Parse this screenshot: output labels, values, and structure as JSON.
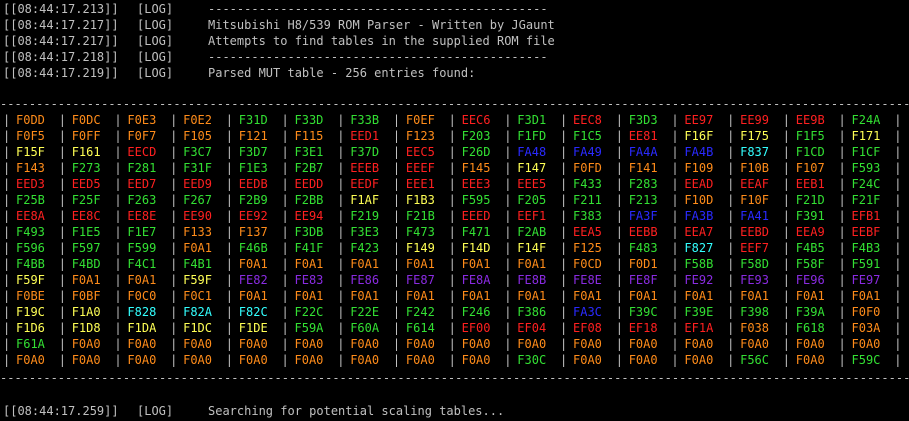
{
  "log_top": [
    {
      "ts": "[[08:44:17.213]]",
      "level": "[LOG]",
      "msg": "-----------------------------------------------"
    },
    {
      "ts": "[[08:44:17.217]]",
      "level": "[LOG]",
      "msg": "Mitsubishi H8/539 ROM Parser - Written by JGaunt"
    },
    {
      "ts": "[[08:44:17.217]]",
      "level": "[LOG]",
      "msg": "Attempts to find tables in the supplied ROM file"
    },
    {
      "ts": "[[08:44:17.218]]",
      "level": "[LOG]",
      "msg": "-----------------------------------------------"
    },
    {
      "ts": "[[08:44:17.219]]",
      "level": "[LOG]",
      "msg": "Parsed MUT table - 256 entries found:"
    }
  ],
  "separator": "-------------------------------------------------------------------------------------------------------------------------------------------",
  "colors": {
    "o": "#ff8c1a",
    "g": "#33e033",
    "r": "#ff2020",
    "y": "#ffff55",
    "b": "#2a2aff",
    "c": "#33ffff",
    "p": "#8a2be2"
  },
  "table": [
    [
      [
        "F0DD",
        "o"
      ],
      [
        "F0DC",
        "o"
      ],
      [
        "F0E3",
        "o"
      ],
      [
        "F0E2",
        "o"
      ],
      [
        "F31D",
        "g"
      ],
      [
        "F33D",
        "g"
      ],
      [
        "F33B",
        "g"
      ],
      [
        "F0EF",
        "o"
      ],
      [
        "EEC6",
        "r"
      ],
      [
        "F3D1",
        "g"
      ],
      [
        "EEC8",
        "r"
      ],
      [
        "F3D3",
        "g"
      ],
      [
        "EE97",
        "r"
      ],
      [
        "EE99",
        "r"
      ],
      [
        "EE9B",
        "r"
      ],
      [
        "F24A",
        "g"
      ]
    ],
    [
      [
        "F0F5",
        "o"
      ],
      [
        "F0FF",
        "o"
      ],
      [
        "F0F7",
        "o"
      ],
      [
        "F105",
        "o"
      ],
      [
        "F121",
        "o"
      ],
      [
        "F115",
        "o"
      ],
      [
        "EED1",
        "r"
      ],
      [
        "F123",
        "o"
      ],
      [
        "F203",
        "g"
      ],
      [
        "F1FD",
        "g"
      ],
      [
        "F1C5",
        "g"
      ],
      [
        "EE81",
        "r"
      ],
      [
        "F16F",
        "y"
      ],
      [
        "F175",
        "y"
      ],
      [
        "F1F5",
        "g"
      ],
      [
        "F171",
        "y"
      ]
    ],
    [
      [
        "F15F",
        "y"
      ],
      [
        "F161",
        "y"
      ],
      [
        "EECD",
        "r"
      ],
      [
        "F3C7",
        "g"
      ],
      [
        "F3D7",
        "g"
      ],
      [
        "F3E1",
        "g"
      ],
      [
        "F37D",
        "g"
      ],
      [
        "EEC5",
        "r"
      ],
      [
        "F26D",
        "g"
      ],
      [
        "FA48",
        "b"
      ],
      [
        "FA49",
        "b"
      ],
      [
        "FA4A",
        "b"
      ],
      [
        "FA4B",
        "b"
      ],
      [
        "F837",
        "c"
      ],
      [
        "F1CD",
        "g"
      ],
      [
        "F1CF",
        "g"
      ]
    ],
    [
      [
        "F143",
        "o"
      ],
      [
        "F273",
        "g"
      ],
      [
        "F281",
        "g"
      ],
      [
        "F31F",
        "g"
      ],
      [
        "F1E3",
        "g"
      ],
      [
        "F2B7",
        "g"
      ],
      [
        "EEEB",
        "r"
      ],
      [
        "EEEF",
        "r"
      ],
      [
        "F145",
        "o"
      ],
      [
        "F147",
        "y"
      ],
      [
        "F0FD",
        "o"
      ],
      [
        "F141",
        "o"
      ],
      [
        "F109",
        "o"
      ],
      [
        "F10B",
        "o"
      ],
      [
        "F107",
        "o"
      ],
      [
        "F593",
        "g"
      ]
    ],
    [
      [
        "EED3",
        "r"
      ],
      [
        "EED5",
        "r"
      ],
      [
        "EED7",
        "r"
      ],
      [
        "EED9",
        "r"
      ],
      [
        "EEDB",
        "r"
      ],
      [
        "EEDD",
        "r"
      ],
      [
        "EEDF",
        "r"
      ],
      [
        "EEE1",
        "r"
      ],
      [
        "EEE3",
        "r"
      ],
      [
        "EEE5",
        "r"
      ],
      [
        "F433",
        "g"
      ],
      [
        "F283",
        "g"
      ],
      [
        "EEAD",
        "r"
      ],
      [
        "EEAF",
        "r"
      ],
      [
        "EEB1",
        "r"
      ],
      [
        "F24C",
        "g"
      ]
    ],
    [
      [
        "F25B",
        "g"
      ],
      [
        "F25F",
        "g"
      ],
      [
        "F263",
        "g"
      ],
      [
        "F267",
        "g"
      ],
      [
        "F2B9",
        "g"
      ],
      [
        "F2BB",
        "g"
      ],
      [
        "F1AF",
        "y"
      ],
      [
        "F1B3",
        "y"
      ],
      [
        "F595",
        "g"
      ],
      [
        "F205",
        "g"
      ],
      [
        "F211",
        "g"
      ],
      [
        "F213",
        "g"
      ],
      [
        "F10D",
        "o"
      ],
      [
        "F10F",
        "o"
      ],
      [
        "F21D",
        "g"
      ],
      [
        "F21F",
        "g"
      ]
    ],
    [
      [
        "EE8A",
        "r"
      ],
      [
        "EE8C",
        "r"
      ],
      [
        "EE8E",
        "r"
      ],
      [
        "EE90",
        "r"
      ],
      [
        "EE92",
        "r"
      ],
      [
        "EE94",
        "r"
      ],
      [
        "F219",
        "g"
      ],
      [
        "F21B",
        "g"
      ],
      [
        "EEED",
        "r"
      ],
      [
        "EEF1",
        "r"
      ],
      [
        "F383",
        "g"
      ],
      [
        "FA3F",
        "b"
      ],
      [
        "FA3B",
        "b"
      ],
      [
        "FA41",
        "b"
      ],
      [
        "F391",
        "g"
      ],
      [
        "EFB1",
        "r"
      ]
    ],
    [
      [
        "F493",
        "g"
      ],
      [
        "F1E5",
        "g"
      ],
      [
        "F1E7",
        "g"
      ],
      [
        "F133",
        "o"
      ],
      [
        "F137",
        "o"
      ],
      [
        "F3DB",
        "g"
      ],
      [
        "F3E3",
        "g"
      ],
      [
        "F473",
        "g"
      ],
      [
        "F471",
        "g"
      ],
      [
        "F2AB",
        "g"
      ],
      [
        "EEA5",
        "r"
      ],
      [
        "EEBB",
        "r"
      ],
      [
        "EEA7",
        "r"
      ],
      [
        "EEBD",
        "r"
      ],
      [
        "EEA9",
        "r"
      ],
      [
        "EEBF",
        "r"
      ]
    ],
    [
      [
        "F596",
        "g"
      ],
      [
        "F597",
        "g"
      ],
      [
        "F599",
        "g"
      ],
      [
        "F0A1",
        "o"
      ],
      [
        "F46B",
        "g"
      ],
      [
        "F41F",
        "g"
      ],
      [
        "F423",
        "g"
      ],
      [
        "F149",
        "y"
      ],
      [
        "F14D",
        "y"
      ],
      [
        "F14F",
        "y"
      ],
      [
        "F125",
        "o"
      ],
      [
        "F483",
        "g"
      ],
      [
        "F827",
        "c"
      ],
      [
        "EEF7",
        "r"
      ],
      [
        "F4B5",
        "g"
      ],
      [
        "F4B3",
        "g"
      ]
    ],
    [
      [
        "F4BB",
        "g"
      ],
      [
        "F4BD",
        "g"
      ],
      [
        "F4C1",
        "g"
      ],
      [
        "F4B1",
        "g"
      ],
      [
        "F0A1",
        "o"
      ],
      [
        "F0A1",
        "o"
      ],
      [
        "F0A1",
        "o"
      ],
      [
        "F0A1",
        "o"
      ],
      [
        "F0A1",
        "o"
      ],
      [
        "F0A1",
        "o"
      ],
      [
        "F0CD",
        "o"
      ],
      [
        "F0D1",
        "o"
      ],
      [
        "F58B",
        "g"
      ],
      [
        "F58D",
        "g"
      ],
      [
        "F58F",
        "g"
      ],
      [
        "F591",
        "g"
      ]
    ],
    [
      [
        "F59F",
        "y"
      ],
      [
        "F0A1",
        "o"
      ],
      [
        "F0A1",
        "o"
      ],
      [
        "F59F",
        "y"
      ],
      [
        "FE82",
        "p"
      ],
      [
        "FE83",
        "p"
      ],
      [
        "FE86",
        "p"
      ],
      [
        "FE87",
        "p"
      ],
      [
        "FE8A",
        "p"
      ],
      [
        "FE8B",
        "p"
      ],
      [
        "FE8E",
        "p"
      ],
      [
        "FE8F",
        "p"
      ],
      [
        "FE92",
        "p"
      ],
      [
        "FE93",
        "p"
      ],
      [
        "FE96",
        "p"
      ],
      [
        "FE97",
        "p"
      ]
    ],
    [
      [
        "F0BE",
        "o"
      ],
      [
        "F0BF",
        "o"
      ],
      [
        "F0C0",
        "o"
      ],
      [
        "F0C1",
        "o"
      ],
      [
        "F0A1",
        "o"
      ],
      [
        "F0A1",
        "o"
      ],
      [
        "F0A1",
        "o"
      ],
      [
        "F0A1",
        "o"
      ],
      [
        "F0A1",
        "o"
      ],
      [
        "F0A1",
        "o"
      ],
      [
        "F0A1",
        "o"
      ],
      [
        "F0A1",
        "o"
      ],
      [
        "F0A1",
        "o"
      ],
      [
        "F0A1",
        "o"
      ],
      [
        "F0A1",
        "o"
      ],
      [
        "F0A1",
        "o"
      ]
    ],
    [
      [
        "F19C",
        "y"
      ],
      [
        "F1A0",
        "y"
      ],
      [
        "F828",
        "c"
      ],
      [
        "F82A",
        "c"
      ],
      [
        "F82C",
        "c"
      ],
      [
        "F22C",
        "g"
      ],
      [
        "F22E",
        "g"
      ],
      [
        "F242",
        "g"
      ],
      [
        "F246",
        "g"
      ],
      [
        "F386",
        "g"
      ],
      [
        "FA3C",
        "b"
      ],
      [
        "F39C",
        "g"
      ],
      [
        "F39E",
        "g"
      ],
      [
        "F398",
        "g"
      ],
      [
        "F39A",
        "g"
      ],
      [
        "F0F0",
        "o"
      ]
    ],
    [
      [
        "F1D6",
        "y"
      ],
      [
        "F1D8",
        "y"
      ],
      [
        "F1DA",
        "y"
      ],
      [
        "F1DC",
        "y"
      ],
      [
        "F1DE",
        "y"
      ],
      [
        "F59A",
        "g"
      ],
      [
        "F60A",
        "g"
      ],
      [
        "F614",
        "g"
      ],
      [
        "EF00",
        "r"
      ],
      [
        "EF04",
        "r"
      ],
      [
        "EF08",
        "r"
      ],
      [
        "EF18",
        "r"
      ],
      [
        "EF1A",
        "r"
      ],
      [
        "F038",
        "o"
      ],
      [
        "F618",
        "g"
      ],
      [
        "F03A",
        "o"
      ]
    ],
    [
      [
        "F61A",
        "g"
      ],
      [
        "F0A0",
        "o"
      ],
      [
        "F0A0",
        "o"
      ],
      [
        "F0A0",
        "o"
      ],
      [
        "F0A0",
        "o"
      ],
      [
        "F0A0",
        "o"
      ],
      [
        "F0A0",
        "o"
      ],
      [
        "F0A0",
        "o"
      ],
      [
        "F0A0",
        "o"
      ],
      [
        "F0A0",
        "o"
      ],
      [
        "F0A0",
        "o"
      ],
      [
        "F0A0",
        "o"
      ],
      [
        "F0A0",
        "o"
      ],
      [
        "F0A0",
        "o"
      ],
      [
        "F0A0",
        "o"
      ],
      [
        "F0A0",
        "o"
      ]
    ],
    [
      [
        "F0A0",
        "o"
      ],
      [
        "F0A0",
        "o"
      ],
      [
        "F0A0",
        "o"
      ],
      [
        "F0A0",
        "o"
      ],
      [
        "F0A0",
        "o"
      ],
      [
        "F0A0",
        "o"
      ],
      [
        "F0A0",
        "o"
      ],
      [
        "F0A0",
        "o"
      ],
      [
        "F0A0",
        "o"
      ],
      [
        "F30C",
        "g"
      ],
      [
        "F0A0",
        "o"
      ],
      [
        "F0A0",
        "o"
      ],
      [
        "F0A0",
        "o"
      ],
      [
        "F56C",
        "g"
      ],
      [
        "F0A0",
        "o"
      ],
      [
        "F59C",
        "g"
      ]
    ]
  ],
  "log_bottom": {
    "ts": "[[08:44:17.259]]",
    "level": "[LOG]",
    "msg": "Searching for potential scaling tables..."
  }
}
